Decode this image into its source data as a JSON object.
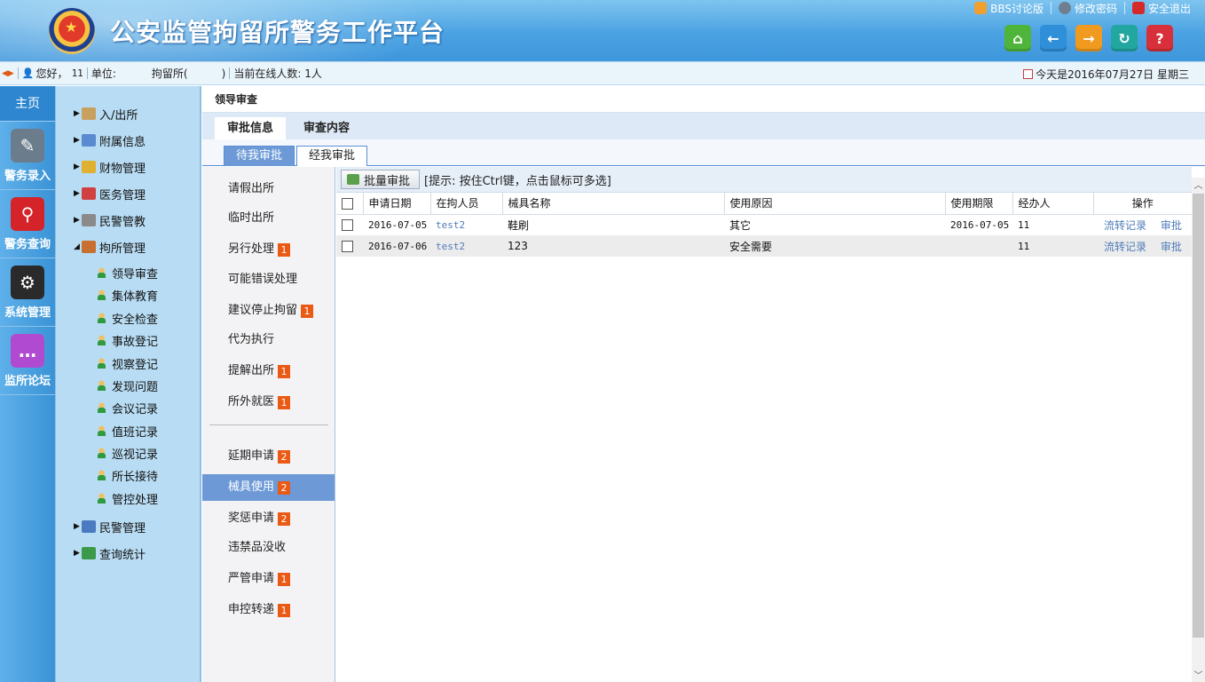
{
  "header": {
    "title": "公安监管拘留所警务工作平台",
    "links": [
      {
        "label": "BBS讨论版",
        "color": "#f0a030"
      },
      {
        "label": "修改密码",
        "color": "#6f7f90"
      },
      {
        "label": "安全退出",
        "color": "#d52a2a"
      }
    ],
    "nav_buttons": [
      {
        "name": "home",
        "glyph": "⌂",
        "color": "#4fb53a"
      },
      {
        "name": "back",
        "glyph": "←",
        "color": "#2f8fd8"
      },
      {
        "name": "forward",
        "glyph": "→",
        "color": "#f09a20"
      },
      {
        "name": "refresh",
        "glyph": "↻",
        "color": "#22a6a0"
      },
      {
        "name": "help",
        "glyph": "?",
        "color": "#d8303a"
      }
    ]
  },
  "infobar": {
    "greeting": "您好，",
    "user": "11",
    "unit_label": "单位:",
    "unit_name": "拘留所(          )",
    "online": "当前在线人数: 1人",
    "date": "今天是2016年07月27日 星期三"
  },
  "leftbar": {
    "home": "主页",
    "modules": [
      {
        "label": "警务录入",
        "icon": "notepad-icon",
        "color": "#6b7c8c",
        "glyph": "✎"
      },
      {
        "label": "警务查询",
        "icon": "magnifier-icon",
        "color": "#d4242a",
        "glyph": "⚲"
      },
      {
        "label": "系统管理",
        "icon": "gear-icon",
        "color": "#2a2a2a",
        "glyph": "⚙"
      },
      {
        "label": "监所论坛",
        "icon": "chat-bubble-icon",
        "color": "#b04ad0",
        "glyph": "…"
      }
    ]
  },
  "tree": {
    "nodes": [
      {
        "label": "入/出所",
        "expanded": false,
        "color": "#c8a060"
      },
      {
        "label": "附属信息",
        "expanded": false,
        "color": "#5a8ad0"
      },
      {
        "label": "财物管理",
        "expanded": false,
        "color": "#e0b030"
      },
      {
        "label": "医务管理",
        "expanded": false,
        "color": "#d04040"
      },
      {
        "label": "民警管教",
        "expanded": false,
        "color": "#8a8a8a"
      },
      {
        "label": "拘所管理",
        "expanded": true,
        "color": "#c87030"
      },
      {
        "label": "民警管理",
        "expanded": false,
        "color": "#4a7ac0"
      },
      {
        "label": "查询统计",
        "expanded": false,
        "color": "#3a9a4a"
      }
    ],
    "children": [
      "领导审查",
      "集体教育",
      "安全检查",
      "事故登记",
      "视察登记",
      "发现问题",
      "会议记录",
      "值班记录",
      "巡视记录",
      "所长接待",
      "管控处理"
    ]
  },
  "main": {
    "crumb": "领导审查",
    "tabs": [
      "审批信息",
      "审查内容"
    ],
    "subtabs": [
      "待我审批",
      "经我审批"
    ],
    "menu": [
      {
        "label": "请假出所",
        "badge": ""
      },
      {
        "label": "临时出所",
        "badge": ""
      },
      {
        "label": "另行处理",
        "badge": "1"
      },
      {
        "label": "可能错误处理",
        "badge": ""
      },
      {
        "label": "建议停止拘留",
        "badge": "1"
      },
      {
        "label": "代为执行",
        "badge": ""
      },
      {
        "label": "提解出所",
        "badge": "1"
      },
      {
        "label": "所外就医",
        "badge": "1"
      },
      {
        "label": "延期申请",
        "badge": "2"
      },
      {
        "label": "械具使用",
        "badge": "2"
      },
      {
        "label": "奖惩申请",
        "badge": "2"
      },
      {
        "label": "违禁品没收",
        "badge": ""
      },
      {
        "label": "严管申请",
        "badge": "1"
      },
      {
        "label": "申控转递",
        "badge": "1"
      }
    ],
    "toolbar": {
      "batch": "批量审批",
      "hint": "[提示: 按住Ctrl键，点击鼠标可多选]"
    },
    "table": {
      "headers": [
        "申请日期",
        "在拘人员",
        "械具名称",
        "使用原因",
        "使用期限",
        "经办人",
        "操作"
      ],
      "rows": [
        {
          "date": "2016-07-05",
          "person": "test2",
          "item": "鞋刷",
          "reason": "其它",
          "term": "2016-07-05",
          "handler": "11",
          "op1": "流转记录",
          "op2": "审批"
        },
        {
          "date": "2016-07-06",
          "person": "test2",
          "item": "123",
          "reason": "安全需要",
          "term": "",
          "handler": "11",
          "op1": "流转记录",
          "op2": "审批"
        }
      ]
    }
  }
}
